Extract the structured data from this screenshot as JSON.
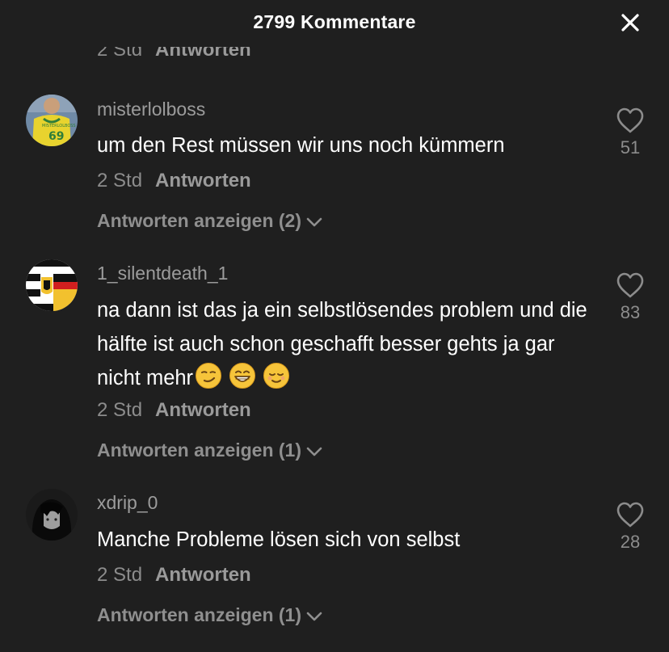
{
  "header": {
    "title": "2799 Kommentare",
    "close_icon": "close-icon"
  },
  "previous": {
    "time": "2 Std",
    "reply_label": "Antworten"
  },
  "comments": [
    {
      "username": "misterlolboss",
      "text": "um den Rest müssen wir uns noch kümmern",
      "time": "2 Std",
      "reply_label": "Antworten",
      "likes": "51",
      "show_replies": "Antworten anzeigen (2)"
    },
    {
      "username": "1_silentdeath_1",
      "text": "na dann ist das ja ein selbstlösendes problem und die hälfte ist auch schon geschafft besser gehts ja gar nicht mehr",
      "emojis": [
        "smirking-face",
        "grinning-face",
        "relieved-face"
      ],
      "time": "2 Std",
      "reply_label": "Antworten",
      "likes": "83",
      "show_replies": "Antworten anzeigen (1)"
    },
    {
      "username": "xdrip_0",
      "text": "Manche Probleme lösen sich von selbst",
      "time": "2 Std",
      "reply_label": "Antworten",
      "likes": "28",
      "show_replies": "Antworten anzeigen (1)"
    }
  ],
  "colors": {
    "background": "#1f1f1f",
    "primary_text": "#ffffff",
    "secondary_text": "#8c8c8c"
  }
}
